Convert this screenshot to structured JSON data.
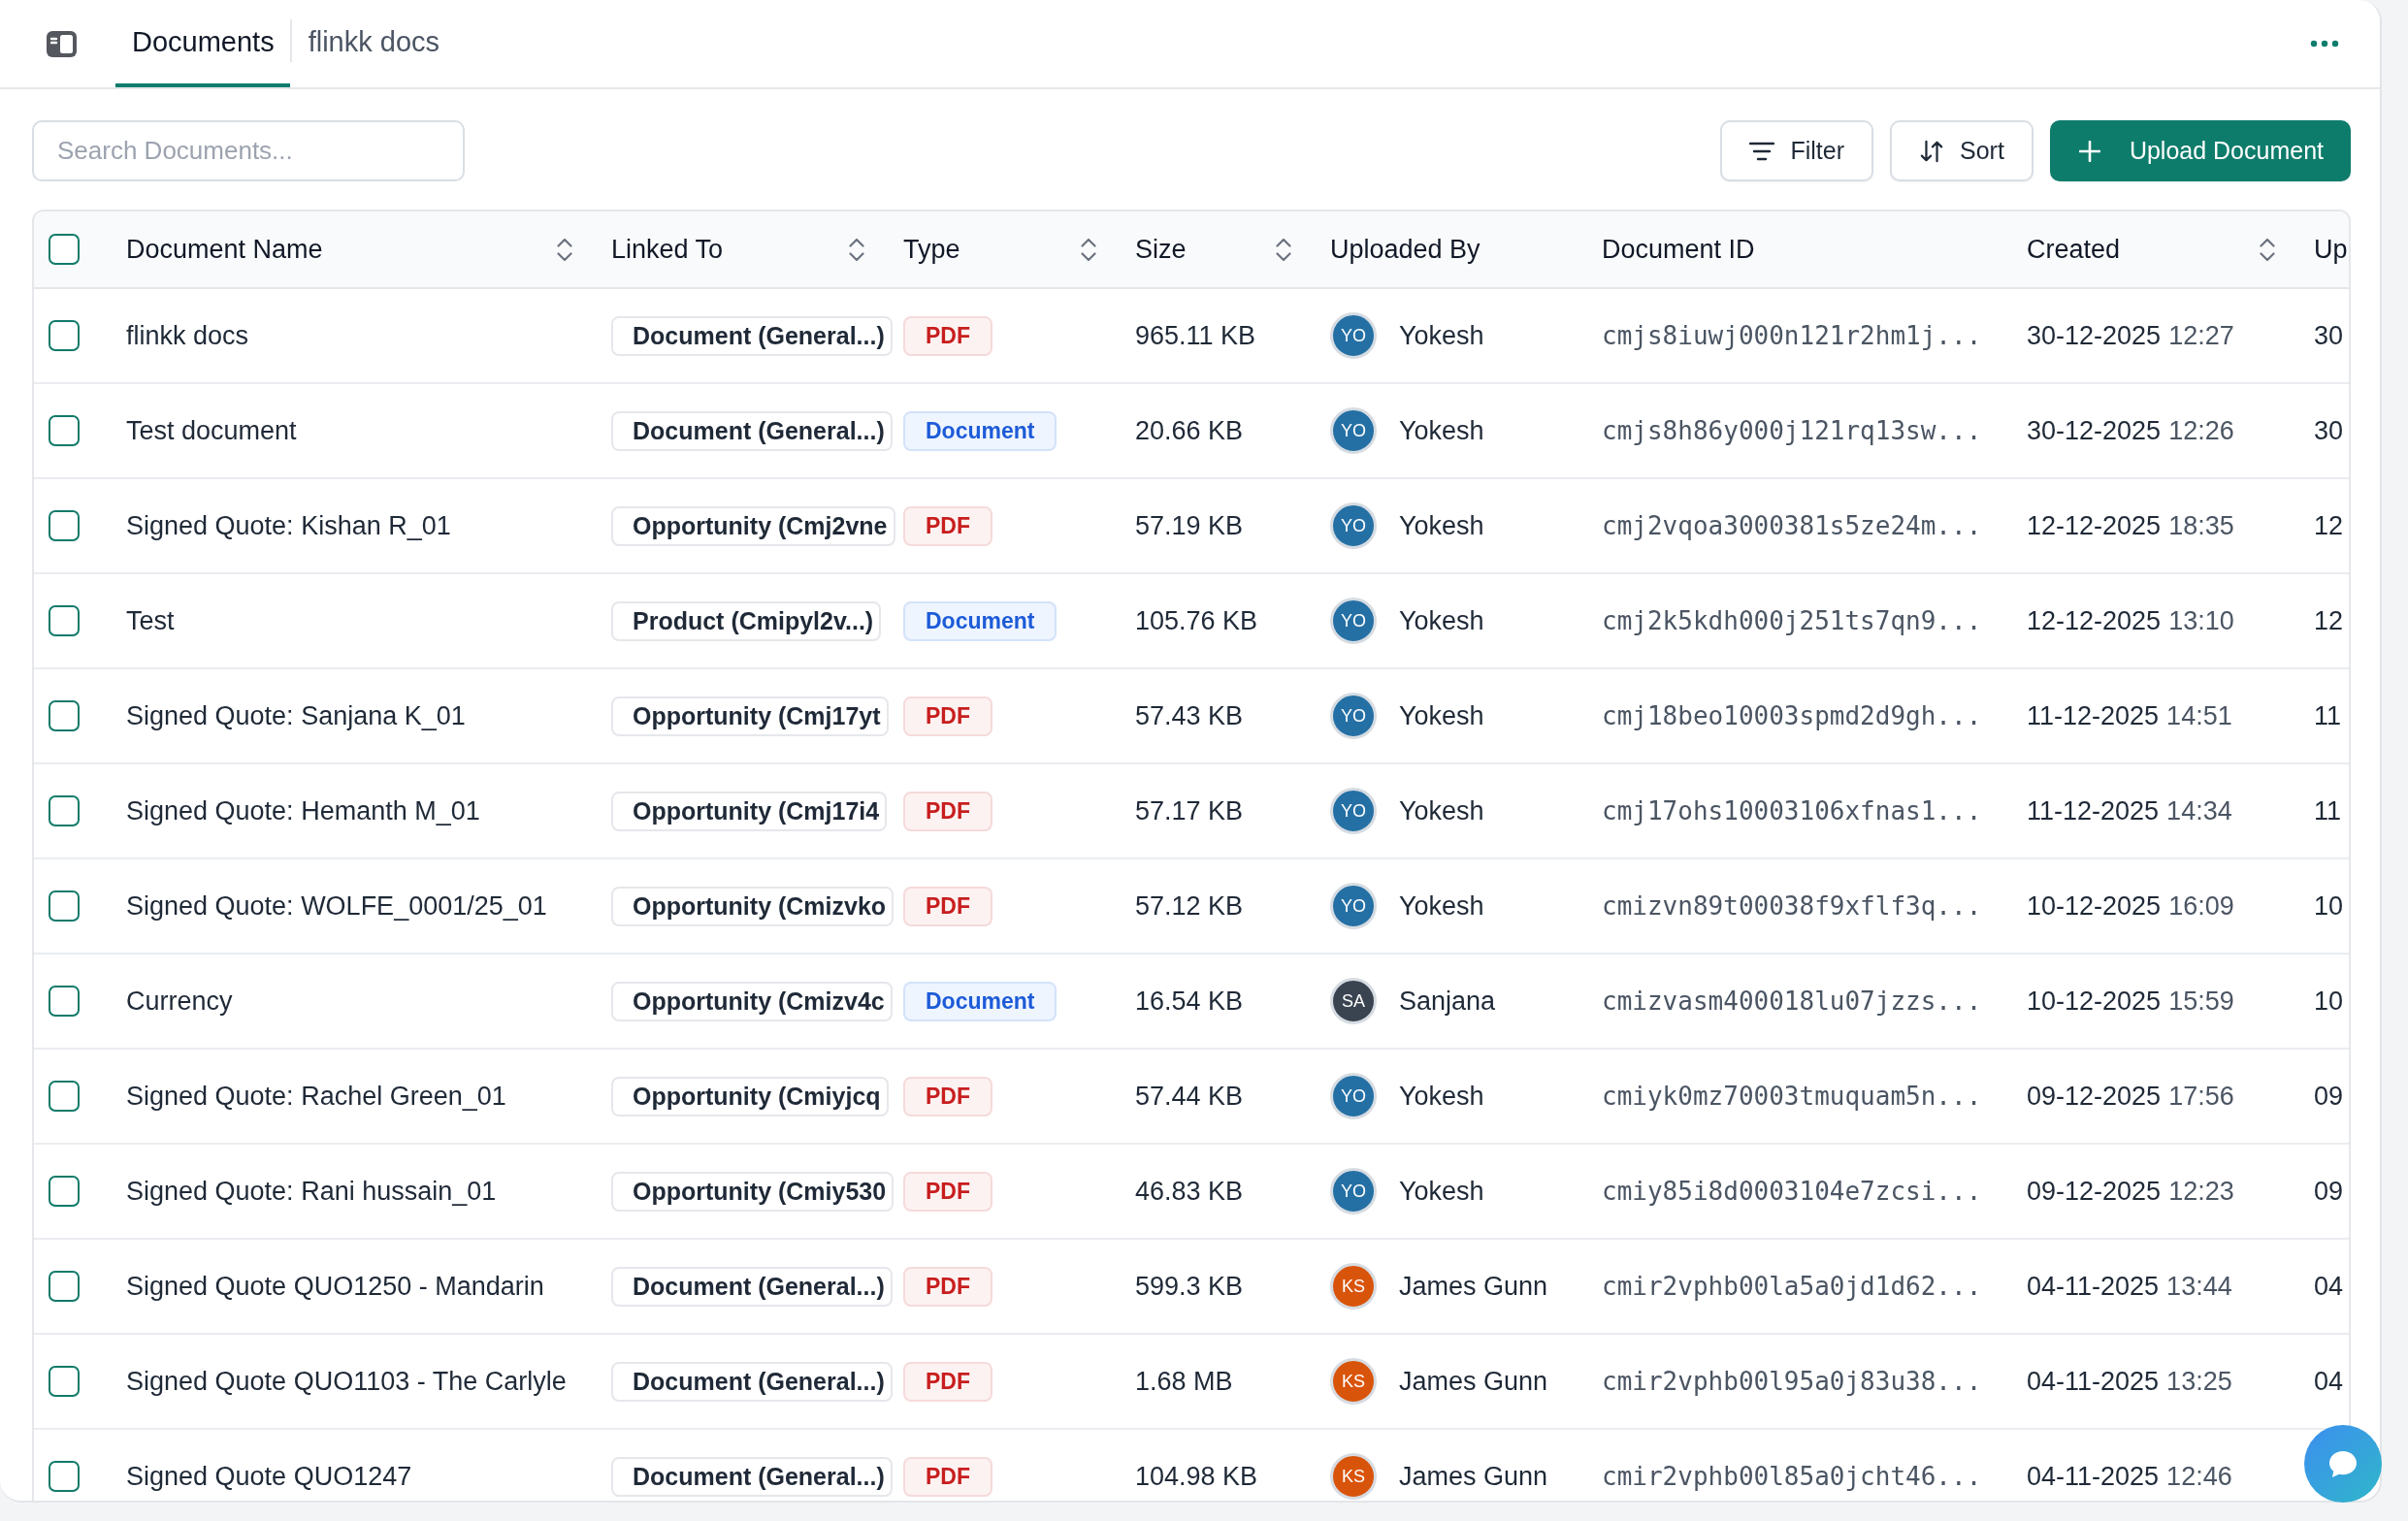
{
  "header": {
    "tabs": [
      {
        "label": "Documents",
        "selected": true
      },
      {
        "label": "flinkk docs",
        "selected": false
      }
    ]
  },
  "toolbar": {
    "search": {
      "placeholder": "Search Documents..."
    },
    "buttons": [
      {
        "label": "Filter",
        "kind": "filter"
      },
      {
        "label": "Sort",
        "kind": "sort"
      },
      {
        "label": "Upload Document",
        "kind": "upload"
      }
    ]
  },
  "table": {
    "select_all": {
      "checked": false
    },
    "columns": [
      {
        "label": "Document Name",
        "sortable": true
      },
      {
        "label": "Linked To",
        "sortable": true
      },
      {
        "label": "Type",
        "sortable": true
      },
      {
        "label": "Size",
        "sortable": true
      },
      {
        "label": "Uploaded By",
        "sortable": false
      },
      {
        "label": "Document ID",
        "sortable": false
      },
      {
        "label": "Created",
        "sortable": true
      },
      {
        "label": "Up",
        "sortable": false
      }
    ],
    "rows": [
      {
        "checked": false,
        "name": "flinkk docs",
        "linked_to": "Document (General...)",
        "type": {
          "label": "PDF",
          "kind": "pdf"
        },
        "size": "965.11 KB",
        "uploader": {
          "initials": "YO",
          "name": "Yokesh",
          "color": "#2470a5"
        },
        "document_id": "cmjs8iuwj000n121r2hm1j...",
        "created_date": "30-12-2025",
        "created_time": "12:27",
        "column_9": "30"
      },
      {
        "checked": false,
        "name": "Test document",
        "linked_to": "Document (General...)",
        "type": {
          "label": "Document",
          "kind": "document"
        },
        "size": "20.66 KB",
        "uploader": {
          "initials": "YO",
          "name": "Yokesh",
          "color": "#2470a5"
        },
        "document_id": "cmjs8h86y000j121rq13sw...",
        "created_date": "30-12-2025",
        "created_time": "12:26",
        "column_9": "30"
      },
      {
        "checked": false,
        "name": "Signed Quote: Kishan R_01",
        "linked_to": "Opportunity (Cmj2vne",
        "type": {
          "label": "PDF",
          "kind": "pdf"
        },
        "size": "57.19 KB",
        "uploader": {
          "initials": "YO",
          "name": "Yokesh",
          "color": "#2470a5"
        },
        "document_id": "cmj2vqoa3000381s5ze24m...",
        "created_date": "12-12-2025",
        "created_time": "18:35",
        "column_9": "12"
      },
      {
        "checked": false,
        "name": "Test",
        "linked_to": "Product (Cmipyl2v...)",
        "type": {
          "label": "Document",
          "kind": "document"
        },
        "size": "105.76 KB",
        "uploader": {
          "initials": "YO",
          "name": "Yokesh",
          "color": "#2470a5"
        },
        "document_id": "cmj2k5kdh000j251ts7qn9...",
        "created_date": "12-12-2025",
        "created_time": "13:10",
        "column_9": "12"
      },
      {
        "checked": false,
        "name": "Signed Quote: Sanjana K_01",
        "linked_to": "Opportunity (Cmj17yt",
        "type": {
          "label": "PDF",
          "kind": "pdf"
        },
        "size": "57.43 KB",
        "uploader": {
          "initials": "YO",
          "name": "Yokesh",
          "color": "#2470a5"
        },
        "document_id": "cmj18beo10003spmd2d9gh...",
        "created_date": "11-12-2025",
        "created_time": "14:51",
        "column_9": "11"
      },
      {
        "checked": false,
        "name": "Signed Quote: Hemanth M_01",
        "linked_to": "Opportunity (Cmj17i4",
        "type": {
          "label": "PDF",
          "kind": "pdf"
        },
        "size": "57.17 KB",
        "uploader": {
          "initials": "YO",
          "name": "Yokesh",
          "color": "#2470a5"
        },
        "document_id": "cmj17ohs10003106xfnas1...",
        "created_date": "11-12-2025",
        "created_time": "14:34",
        "column_9": "11"
      },
      {
        "checked": false,
        "name": "Signed Quote: WOLFE_0001/25_01",
        "linked_to": "Opportunity (Cmizvko",
        "type": {
          "label": "PDF",
          "kind": "pdf"
        },
        "size": "57.12 KB",
        "uploader": {
          "initials": "YO",
          "name": "Yokesh",
          "color": "#2470a5"
        },
        "document_id": "cmizvn89t00038f9xflf3q...",
        "created_date": "10-12-2025",
        "created_time": "16:09",
        "column_9": "10"
      },
      {
        "checked": false,
        "name": "Currency",
        "linked_to": "Opportunity (Cmizv4c",
        "type": {
          "label": "Document",
          "kind": "document"
        },
        "size": "16.54 KB",
        "uploader": {
          "initials": "SA",
          "name": "Sanjana",
          "color": "#3a4350"
        },
        "document_id": "cmizvasm400018lu07jzzs...",
        "created_date": "10-12-2025",
        "created_time": "15:59",
        "column_9": "10"
      },
      {
        "checked": false,
        "name": "Signed Quote: Rachel Green_01",
        "linked_to": "Opportunity (Cmiyjcq",
        "type": {
          "label": "PDF",
          "kind": "pdf"
        },
        "size": "57.44 KB",
        "uploader": {
          "initials": "YO",
          "name": "Yokesh",
          "color": "#2470a5"
        },
        "document_id": "cmiyk0mz70003tmuquam5n...",
        "created_date": "09-12-2025",
        "created_time": "17:56",
        "column_9": "09"
      },
      {
        "checked": false,
        "name": "Signed Quote: Rani hussain_01",
        "linked_to": "Opportunity (Cmiy530",
        "type": {
          "label": "PDF",
          "kind": "pdf"
        },
        "size": "46.83 KB",
        "uploader": {
          "initials": "YO",
          "name": "Yokesh",
          "color": "#2470a5"
        },
        "document_id": "cmiy85i8d0003104e7zcsi...",
        "created_date": "09-12-2025",
        "created_time": "12:23",
        "column_9": "09"
      },
      {
        "checked": false,
        "name": "Signed Quote QUO1250 - Mandarin",
        "linked_to": "Document (General...)",
        "type": {
          "label": "PDF",
          "kind": "pdf"
        },
        "size": "599.3 KB",
        "uploader": {
          "initials": "KS",
          "name": "James Gunn",
          "color": "#d9540b"
        },
        "document_id": "cmir2vphb00la5a0jd1d62...",
        "created_date": "04-11-2025",
        "created_time": "13:44",
        "column_9": "04"
      },
      {
        "checked": false,
        "name": "Signed Quote QUO1103 - The Carlyle",
        "linked_to": "Document (General...)",
        "type": {
          "label": "PDF",
          "kind": "pdf"
        },
        "size": "1.68 MB",
        "uploader": {
          "initials": "KS",
          "name": "James Gunn",
          "color": "#d9540b"
        },
        "document_id": "cmir2vphb00l95a0j83u38...",
        "created_date": "04-11-2025",
        "created_time": "13:25",
        "column_9": "04"
      },
      {
        "checked": false,
        "name": "Signed Quote QUO1247",
        "linked_to": "Document (General...)",
        "type": {
          "label": "PDF",
          "kind": "pdf"
        },
        "size": "104.98 KB",
        "uploader": {
          "initials": "KS",
          "name": "James Gunn",
          "color": "#d9540b"
        },
        "document_id": "cmir2vphb00l85a0jcht46...",
        "created_date": "04-11-2025",
        "created_time": "12:46"
      }
    ]
  }
}
